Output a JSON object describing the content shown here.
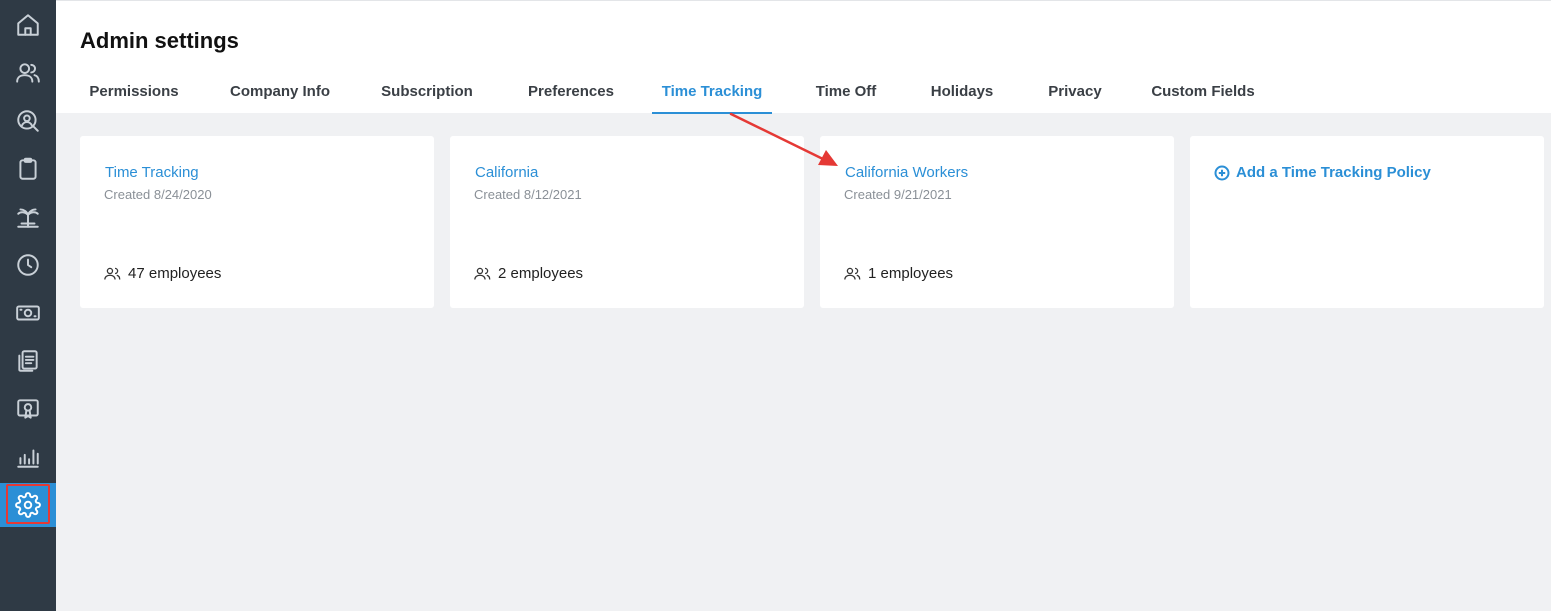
{
  "header": {
    "title": "Admin settings"
  },
  "tabs": [
    {
      "label": "Permissions"
    },
    {
      "label": "Company Info"
    },
    {
      "label": "Subscription"
    },
    {
      "label": "Preferences"
    },
    {
      "label": "Time Tracking",
      "active": true
    },
    {
      "label": "Time Off"
    },
    {
      "label": "Holidays"
    },
    {
      "label": "Privacy"
    },
    {
      "label": "Custom Fields"
    }
  ],
  "sidebar": {
    "items": [
      {
        "icon": "home-icon"
      },
      {
        "icon": "people-icon"
      },
      {
        "icon": "person-search-icon"
      },
      {
        "icon": "clipboard-icon"
      },
      {
        "icon": "palm-tree-icon"
      },
      {
        "icon": "clock-icon"
      },
      {
        "icon": "money-icon"
      },
      {
        "icon": "documents-icon"
      },
      {
        "icon": "certificate-icon"
      },
      {
        "icon": "bar-chart-icon"
      },
      {
        "icon": "gear-icon",
        "active": true
      }
    ]
  },
  "policies": [
    {
      "name": "Time Tracking",
      "created": "Created 8/24/2020",
      "employees": "47 employees"
    },
    {
      "name": "California",
      "created": "Created 8/12/2021",
      "employees": "2 employees"
    },
    {
      "name": "California Workers",
      "created": "Created 9/21/2021",
      "employees": "1 employees"
    }
  ],
  "add_policy": {
    "label": "Add a Time Tracking Policy"
  },
  "colors": {
    "accent": "#2b8fd6",
    "sidebar": "#2f3a45",
    "annotation": "#e53935"
  }
}
